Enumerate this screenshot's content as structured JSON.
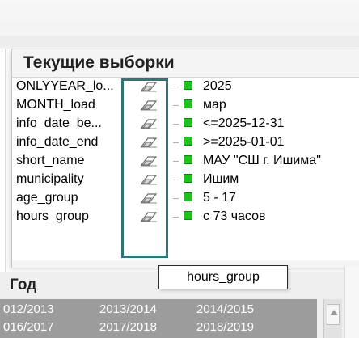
{
  "current_selections": {
    "title": "Текущие выборки",
    "rows": [
      {
        "field": "ONLYYEAR_lo...",
        "value": "2025"
      },
      {
        "field": "MONTH_load",
        "value": "мар"
      },
      {
        "field": "info_date_be...",
        "value": "<=2025-12-31"
      },
      {
        "field": "info_date_end",
        "value": ">=2025-01-01"
      },
      {
        "field": "short_name",
        "value": "МАУ \"СШ г. Ишима\""
      },
      {
        "field": "municipality",
        "value": "Ишим"
      },
      {
        "field": "age_group",
        "value": "5 - 17"
      },
      {
        "field": "hours_group",
        "value": "с 73 часов"
      }
    ],
    "clear_icon": "eraser-icon",
    "status_color": "#1ec21e"
  },
  "tooltip": {
    "text": "hours_group"
  },
  "year_listbox": {
    "title": "Год",
    "rows": [
      [
        "012/2013",
        "2013/2014",
        "2014/2015"
      ],
      [
        "016/2017",
        "2017/2018",
        "2018/2019"
      ]
    ]
  },
  "colors": {
    "highlight": "#2f7478",
    "year_bg": "#9c9c9c"
  }
}
